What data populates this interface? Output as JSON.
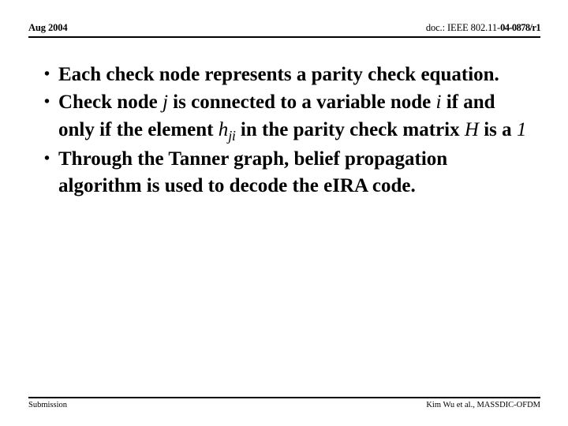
{
  "header": {
    "date": "Aug 2004",
    "doc_label": "doc.: IEEE 802.11-",
    "doc_number": "04-0878/r1"
  },
  "body": {
    "bullets": [
      {
        "marker": "•",
        "segments": [
          {
            "text": "Each check node represents a parity check equation.",
            "style": "normal"
          }
        ]
      },
      {
        "marker": "•",
        "segments": [
          {
            "text": "Check node ",
            "style": "normal"
          },
          {
            "text": "j",
            "style": "italic"
          },
          {
            "text": " is connected to a variable node ",
            "style": "normal"
          },
          {
            "text": "i",
            "style": "italic"
          },
          {
            "text": " if and only if the element ",
            "style": "normal"
          },
          {
            "text": "h",
            "style": "italic"
          },
          {
            "text": "ji",
            "style": "italic-sub"
          },
          {
            "text": " in the parity check matrix ",
            "style": "normal"
          },
          {
            "text": "H",
            "style": "italic"
          },
          {
            "text": " is a ",
            "style": "normal"
          },
          {
            "text": "1",
            "style": "italic"
          }
        ]
      },
      {
        "marker": "•",
        "segments": [
          {
            "text": "Through the Tanner graph, belief propagation algorithm is used to decode the eIRA code.",
            "style": "normal"
          }
        ]
      }
    ]
  },
  "footer": {
    "left": "Submission",
    "right": "Kim Wu et al., MASSDIC-OFDM"
  },
  "colors": {
    "text": "#000000",
    "background": "#ffffff",
    "rule": "#000000"
  }
}
